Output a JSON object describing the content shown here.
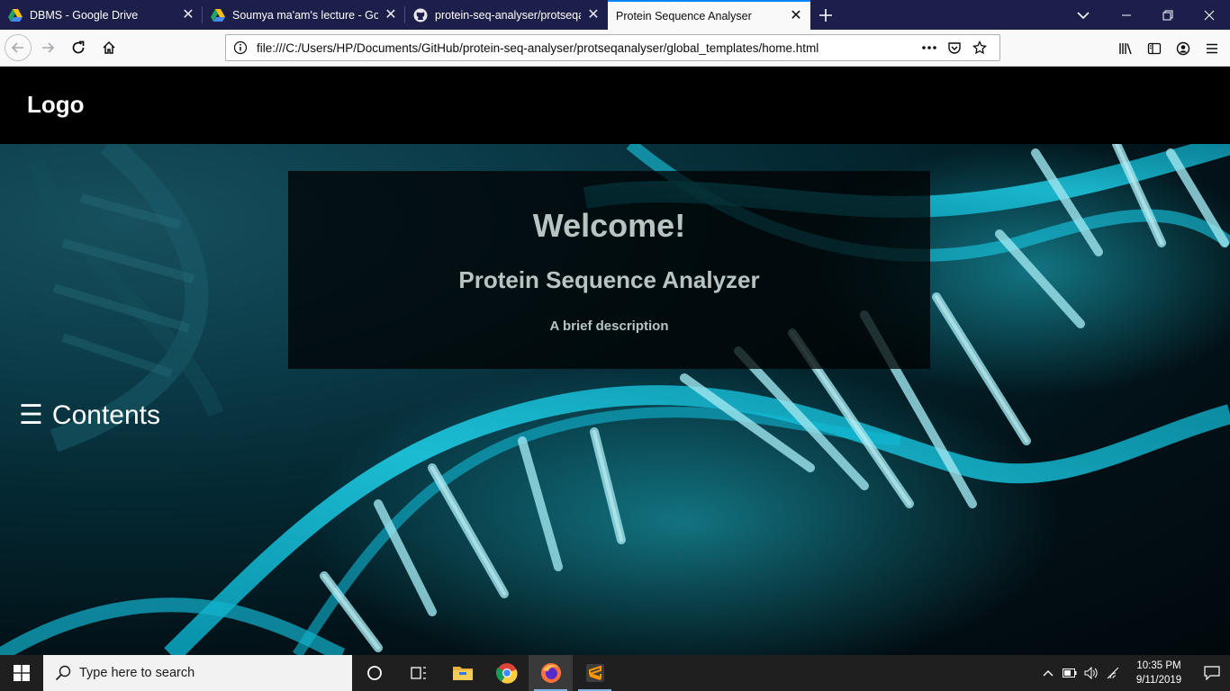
{
  "browser": {
    "tabs": [
      {
        "title": "DBMS - Google Drive",
        "icon": "google-drive-icon",
        "active": false
      },
      {
        "title": "Soumya ma'am's lecture - Google Drive",
        "icon": "google-drive-icon",
        "active": false
      },
      {
        "title": "protein-seq-analyser/protseqanalyser",
        "icon": "github-icon",
        "active": false
      },
      {
        "title": "Protein Sequence Analyser",
        "icon": "none",
        "active": true
      }
    ],
    "url": "file:///C:/Users/HP/Documents/GitHub/protein-seq-analyser/protseqanalyser/global_templates/home.html",
    "accent_color": "#0a84ff",
    "tabstrip_color": "#1d1f4b"
  },
  "page": {
    "logo": "Logo",
    "welcome": {
      "title": "Welcome!",
      "subtitle": "Protein Sequence Analyzer",
      "description": "A brief description"
    },
    "contents_icon": "☰",
    "contents_label": "Contents"
  },
  "taskbar": {
    "search_placeholder": "Type here to search",
    "apps": [
      "task-view-icon",
      "file-explorer-icon",
      "chrome-icon",
      "firefox-icon",
      "sublime-text-icon"
    ],
    "clock_time": "10:35 PM",
    "clock_date": "9/11/2019"
  }
}
